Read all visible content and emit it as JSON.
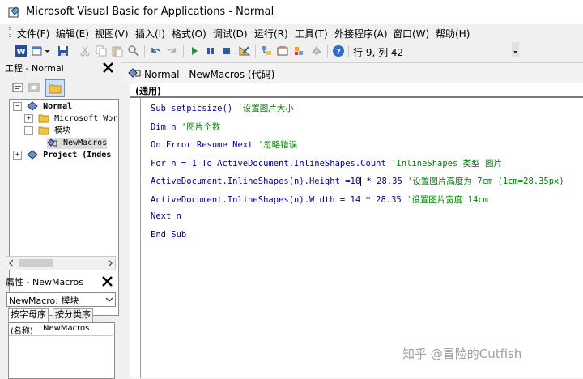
{
  "window": {
    "title": "Microsoft Visual Basic for Applications - Normal"
  },
  "menu": {
    "items": [
      "文件(F)",
      "编辑(E)",
      "视图(V)",
      "插入(I)",
      "格式(O)",
      "调试(D)",
      "运行(R)",
      "工具(T)",
      "外接程序(A)",
      "窗口(W)",
      "帮助(H)"
    ]
  },
  "toolbar": {
    "position_readout": "行 9, 列 42",
    "icons": [
      "word-icon",
      "insert-userform-icon",
      "save-icon",
      "cut-icon",
      "copy-icon",
      "paste-icon",
      "find-icon",
      "undo-icon",
      "redo-icon",
      "run-icon",
      "break-icon",
      "reset-icon",
      "design-mode-icon",
      "project-explorer-icon",
      "properties-window-icon",
      "object-browser-icon",
      "toolbox-icon",
      "help-icon"
    ]
  },
  "project_panel": {
    "title": "工程 - Normal",
    "tree": {
      "root": "Normal",
      "microsoft_word": "Microsoft Wor",
      "modules": "模块",
      "module_item": "NewMacros",
      "project2": "Project (Indes"
    }
  },
  "properties_panel": {
    "title": "属性 - NewMacros",
    "object_select": "NewMacro: 模块",
    "tabs": [
      "按字母序",
      "按分类序"
    ],
    "row": {
      "name": "(名称)",
      "value": "NewMacros"
    }
  },
  "code_window": {
    "title": "Normal - NewMacros (代码)",
    "object_dropdown": "(通用)",
    "lines": [
      {
        "code": "Sub setpicsize() ",
        "comment": "'设置图片大小"
      },
      {
        "code": "Dim n ",
        "comment": "'图片个数"
      },
      {
        "code": "On Error Resume Next ",
        "comment": "'忽略错误"
      },
      {
        "code": "For n = 1 To ActiveDocument.InlineShapes.Count ",
        "comment": "'InlineShapes 类型 图片"
      },
      {
        "code_before_caret": "ActiveDocument.InlineShapes(n).Height =10",
        "code_after_caret": " * 28.35 ",
        "comment": "'设置图片高度为 7cm  (1cm=28.35px)"
      },
      {
        "code": "ActiveDocument.InlineShapes(n).Width = 14 * 28.35 ",
        "comment": "'设置图片宽度 14cm"
      },
      {
        "code": "Next n",
        "comment": ""
      },
      {
        "code": "End Sub",
        "comment": ""
      }
    ]
  },
  "watermark": "知乎 @冒险的Cutfish"
}
